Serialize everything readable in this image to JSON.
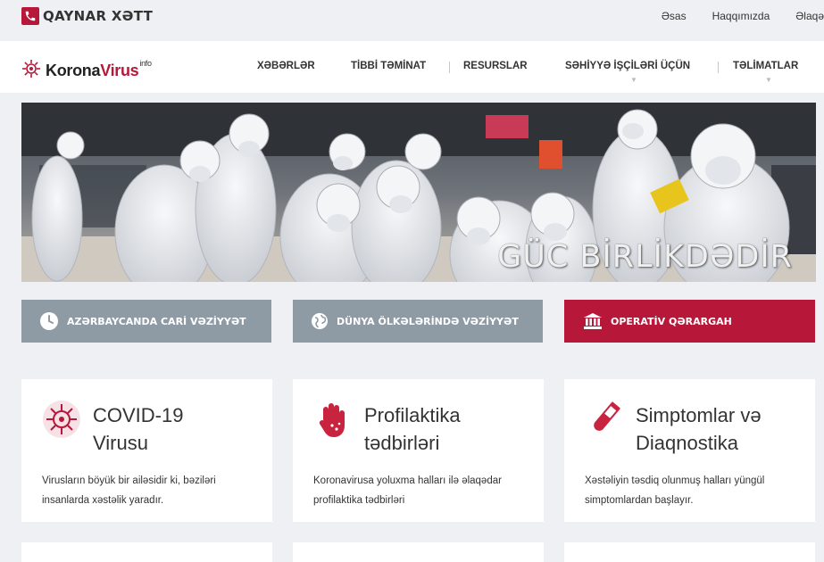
{
  "topbar": {
    "hotline_label": "QAYNAR XƏTT",
    "links": [
      "Əsas",
      "Haqqımızda",
      "Əlaqə"
    ]
  },
  "header": {
    "logo_prefix": "Korona",
    "logo_accent": "Virus",
    "logo_sup": "info",
    "nav": [
      "XƏBƏRLƏR",
      "TİBBİ TƏMİNAT",
      "RESURSLAR",
      "SƏHİYYƏ İŞÇİLƏRİ ÜÇÜN",
      "TƏLİMATLAR"
    ]
  },
  "hero": {
    "caption": "GÜC BİRLİKDƏDİR"
  },
  "buttons": [
    {
      "label": "AZƏRBAYCANDA CARİ VƏZİYYƏT",
      "icon": "clock-icon"
    },
    {
      "label": "DÜNYA ÖLKƏLƏRİNDƏ VƏZİYYƏT",
      "icon": "globe-icon"
    },
    {
      "label": "OPERATİV QƏRARGAH",
      "icon": "bank-icon"
    }
  ],
  "cards": [
    {
      "title_1": "COVID-19",
      "title_2": "Virusu",
      "text": "Virusların böyük bir ailəsidir ki, bəziləri insanlarda xəstəlik yaradır.",
      "icon": "virus-icon"
    },
    {
      "title_1": "Profilaktika",
      "title_2": "tədbirləri",
      "text": "Koronavirusa yoluxma halları ilə əlaqədar profilaktika tədbirləri",
      "icon": "hand-icon"
    },
    {
      "title_1": "Simptomlar və",
      "title_2": "Diaqnostika",
      "text": "Xəstəliyin təsdiq olunmuş halları yüngül simptomlardan başlayır.",
      "icon": "test-tube-icon"
    }
  ],
  "colors": {
    "accent": "#b7183a",
    "button_grey": "#8e9ba5",
    "page_bg": "#eef0f3"
  }
}
